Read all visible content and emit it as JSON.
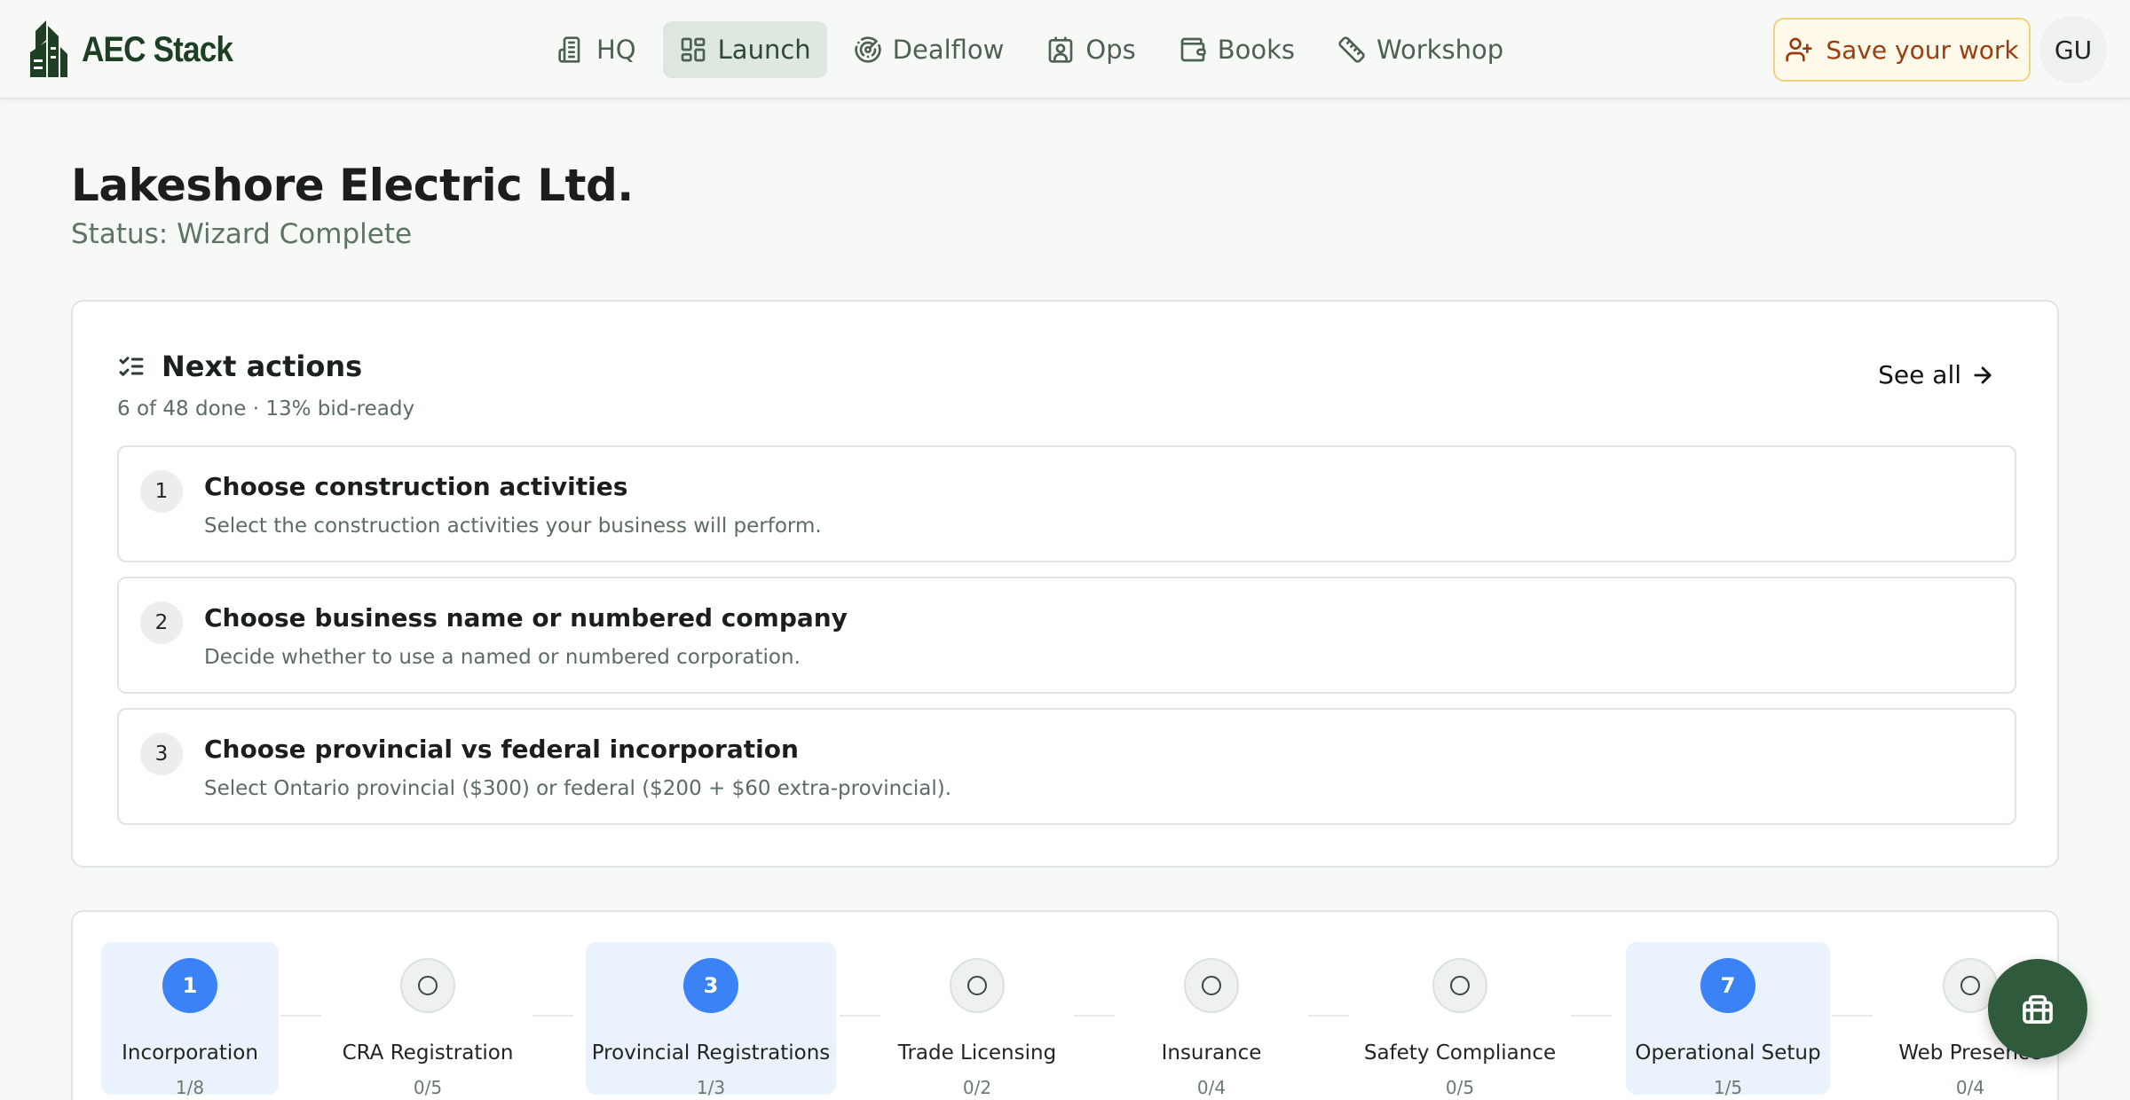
{
  "brand": {
    "name": "AEC Stack",
    "icon": "building-logo-icon"
  },
  "nav": {
    "items": [
      {
        "label": "HQ",
        "icon": "building-icon",
        "active": false
      },
      {
        "label": "Launch",
        "icon": "layout-grid-icon",
        "active": true
      },
      {
        "label": "Dealflow",
        "icon": "radar-icon",
        "active": false
      },
      {
        "label": "Ops",
        "icon": "contact-badge-icon",
        "active": false
      },
      {
        "label": "Books",
        "icon": "wallet-icon",
        "active": false
      },
      {
        "label": "Workshop",
        "icon": "ruler-icon",
        "active": false
      }
    ],
    "save_label": "Save your work",
    "avatar_initials": "GU"
  },
  "company": {
    "name": "Lakeshore Electric Ltd.",
    "status": "Status: Wizard Complete"
  },
  "next_actions": {
    "title": "Next actions",
    "summary": "6 of 48 done · 13% bid-ready",
    "see_all": "See all",
    "tasks": [
      {
        "num": "1",
        "title": "Choose construction activities",
        "desc": "Select the construction activities your business will perform."
      },
      {
        "num": "2",
        "title": "Choose business name or numbered company",
        "desc": "Decide whether to use a named or numbered corporation."
      },
      {
        "num": "3",
        "title": "Choose provincial vs federal incorporation",
        "desc": "Select Ontario provincial ($300) or federal ($200 + $60 extra-provincial)."
      }
    ]
  },
  "steps": [
    {
      "num": "1",
      "name": "Incorporation",
      "count": "1/8",
      "current": true
    },
    {
      "num": "",
      "name": "CRA Registration",
      "count": "0/5",
      "current": false
    },
    {
      "num": "3",
      "name": "Provincial Registrations",
      "count": "1/3",
      "current": true
    },
    {
      "num": "",
      "name": "Trade Licensing",
      "count": "0/2",
      "current": false
    },
    {
      "num": "",
      "name": "Insurance",
      "count": "0/4",
      "current": false
    },
    {
      "num": "",
      "name": "Safety Compliance",
      "count": "0/5",
      "current": false
    },
    {
      "num": "7",
      "name": "Operational Setup",
      "count": "1/5",
      "current": true
    },
    {
      "num": "",
      "name": "Web Presence",
      "count": "0/4",
      "current": false
    }
  ],
  "fab": {
    "icon": "gift-icon"
  },
  "colors": {
    "brand": "#1e3f24",
    "accent": "#3b82f6",
    "save_text": "#9a3d10",
    "fab": "#2f5b3c"
  }
}
